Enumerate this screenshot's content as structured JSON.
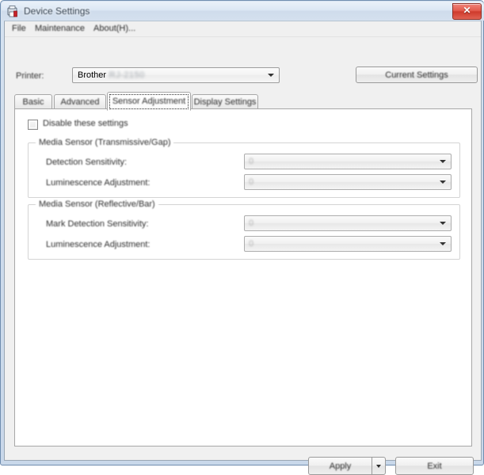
{
  "window": {
    "title": "Device Settings",
    "icon": "printer-app-icon",
    "close_label": "✕"
  },
  "menubar": {
    "items": [
      {
        "label": "File"
      },
      {
        "label": "Maintenance"
      },
      {
        "label": "About(H)..."
      }
    ]
  },
  "printer_row": {
    "label": "Printer:",
    "brand": "Brother",
    "model": "RJ-2150",
    "current_settings_label": "Current Settings"
  },
  "tabs": [
    {
      "label": "Basic",
      "selected": false
    },
    {
      "label": "Advanced",
      "selected": false
    },
    {
      "label": "Sensor Adjustment",
      "selected": true
    },
    {
      "label": "Display Settings",
      "selected": false
    }
  ],
  "panel": {
    "disable_checkbox": {
      "label": "Disable these settings",
      "checked": false
    },
    "groups": [
      {
        "title": "Media Sensor (Transmissive/Gap)",
        "fields": [
          {
            "label": "Detection Sensitivity:",
            "value": "0",
            "enabled": false
          },
          {
            "label": "Luminescence Adjustment:",
            "value": "0",
            "enabled": false
          }
        ]
      },
      {
        "title": "Media Sensor (Reflective/Bar)",
        "fields": [
          {
            "label": "Mark Detection Sensitivity:",
            "value": "0",
            "enabled": false
          },
          {
            "label": "Luminescence Adjustment:",
            "value": "0",
            "enabled": false
          }
        ]
      }
    ]
  },
  "footer": {
    "apply_label": "Apply",
    "exit_label": "Exit"
  },
  "colors": {
    "window_chrome": "#cfdcec",
    "client_bg": "#f0f0f0",
    "panel_bg": "#ffffff",
    "close_red": "#cf3a2c",
    "group_border": "#d4d4d4"
  }
}
